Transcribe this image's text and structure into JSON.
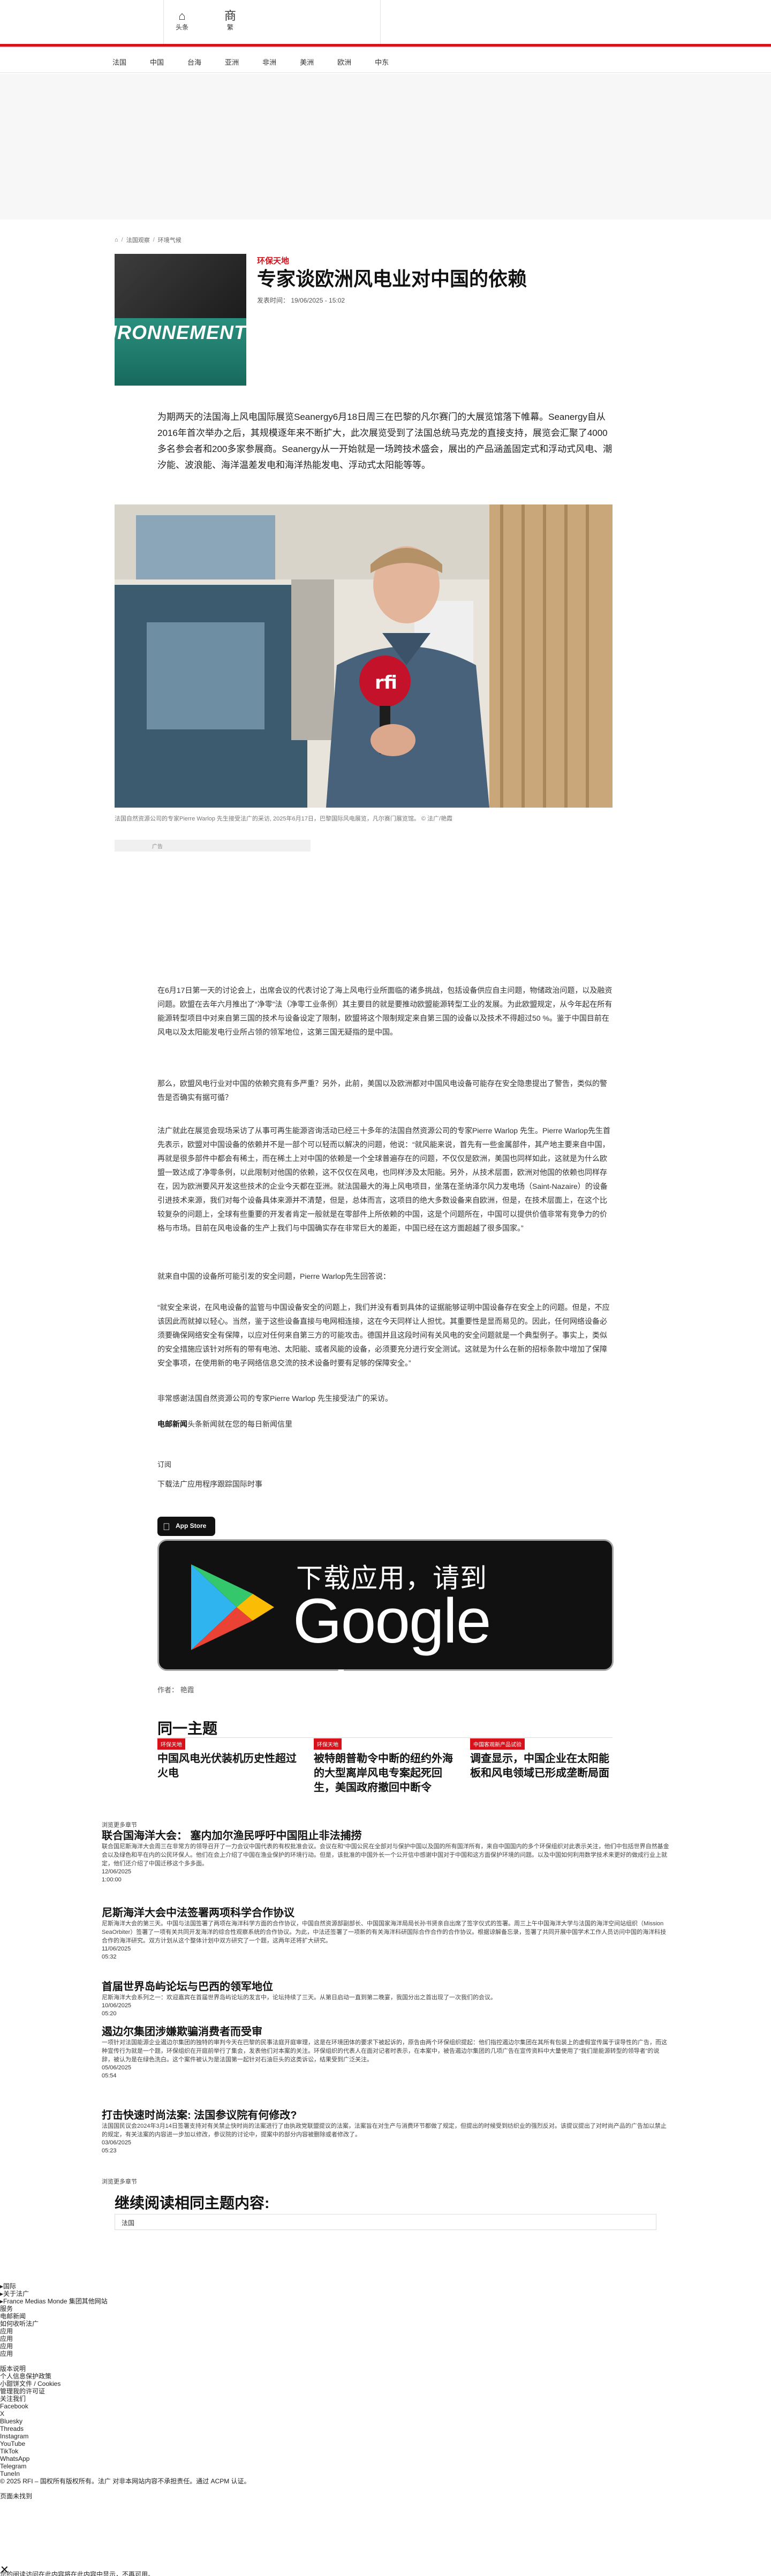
{
  "topbar": {
    "home_label": "头条",
    "translate_label": "繁"
  },
  "nav": [
    "法国",
    "中国",
    "台海",
    "亚洲",
    "非洲",
    "美洲",
    "欧洲",
    "中东"
  ],
  "breadcrumb": [
    "法国观察",
    "环境气候"
  ],
  "article": {
    "category": "环保天地",
    "title": "专家谈欧洲风电业对中国的依赖",
    "date": "发表时间： 19/06/2025 - 15:02",
    "thumb_text": "IRONNEMENT",
    "lead": "为期两天的法国海上风电国际展览Seanergy6月18日周三在巴黎的凡尔赛门的大展览馆落下帷幕。Seanergy自从2016年首次举办之后，其规模逐年来不断扩大，此次展览受到了法国总统马克龙的直接支持，展览会汇聚了4000多名参会者和200多家参展商。Seanergy从一开始就是一场跨技术盛会，展出的产品涵盖固定式和浮动式风电、潮汐能、波浪能、海洋温差发电和海洋热能发电、浮动式太阳能等等。",
    "photo_caption": "法国自然资源公司的专家Pierre Warlop  先生接受法广的采访, 2025年6月17日，巴黎国际风电展览，凡尔赛门展览馆。 © 法广/艳霞",
    "ad_label": "广告",
    "paragraphs": [
      "在6月17日第一天的讨论会上，出席会议的代表讨论了海上风电行业所面临的诸多挑战，包括设备供应自主问题，物储政治问题，以及融资问题。欧盟在去年六月推出了“净零”法（净零工业条例）其主要目的就是要推动欧盟能源转型工业的发展。为此欧盟规定，从今年起在所有能源转型项目中对来自第三国的技术与设备设定了限制，欧盟将这个限制规定来自第三国的设备以及技术不得超过50 %。鉴于中国目前在风电以及太阳能发电行业所占领的领军地位，这第三国无疑指的是中国。",
      "那么，欧盟风电行业对中国的依赖究竟有多严重？另外，此前，美国以及欧洲都对中国风电设备可能存在安全隐患提出了警告，类似的警告是否确实有据可循？",
      "法广就此在展览会现场采访了从事可再生能源咨询活动已经三十多年的法国自然资源公司的专家Pierre Warlop  先生。Pierre Warlop先生首先表示，欧盟对中国设备的依赖并不是一部个可以轻而以解决的问题，他说：“就风能来说，首先有一些金属部件，其产地主要来自中国，再就是很多部件中都会有稀土，而在稀土上对中国的依赖是一个全球普遍存在的问题，不仅仅是欧洲，美国也同样如此，这就是为什么欧盟一致达成了净零条例，以此限制对他国的依赖，这不仅仅在风电，也同样涉及太阳能。另外，从技术层面，欧洲对他国的依赖也同样存在，因为欧洲要风开发这些技术的企业今天都在亚洲。就法国最大的海上风电项目，坐落在圣纳泽尔风力发电场（Saint-Nazaire）的设备引进技术来源，我们对每个设备具体来源并不清楚，但是，总体而言，这项目的绝大多数设备来自欧洲，但是，在技术层面上，在这个比较复杂的问题上，全球有些重要的开发者肯定一般就是在零部件上所依赖的中国，这是个问题所在，中国可以提供价值非常有竞争力的价格与市场。目前在风电设备的生产上我们与中国确实存在非常巨大的差距，中国已经在这方面超越了很多国家。”",
      "就来自中国的设备所可能引发的安全问题，Pierre Warlop先生回答说：",
      "“就安全来说，在风电设备的监管与中国设备安全的问题上，我们并没有看到具体的证据能够证明中国设备存在安全上的问题。但是，不应该因此而就掉以轻心。当然，鉴于这些设备直接与电网相连接，这在今天同样让人担忧。其重要性是显而易见的。因此，任何网络设备必须要确保网络安全有保障，以应对任何来自第三方的可能攻击。德国并且这段时间有关风电的安全问题就是一个典型例子。事实上，类似的安全措施应该针对所有的带有电池、太阳能、或者风能的设备，必须要充分进行安全测试。这就是为什么在新的招标条款中增加了保障安全事项，在使用新的电子网络信息交流的技术设备时要有足够的保障安全。”",
      "非常感谢法国自然资源公司的专家Pierre Warlop  先生接受法广的采访。"
    ],
    "newsletter_prefix": "电邮新闻",
    "newsletter_text": "头条新闻就在您的每日新闻信里",
    "subscribe": "订阅",
    "download_text": "下载法广应用程序跟踪国际时事",
    "app_store": "App Store",
    "gplay_small": "下载应用，请到",
    "gplay_big": "Google Play",
    "author": "作者： 艳霞"
  },
  "related": {
    "heading": "同一主题",
    "items": [
      {
        "tag": "环保天地",
        "title": "中国风电光伏装机历史性超过火电"
      },
      {
        "tag": "环保天地",
        "title": "被特朗普勒令中断的纽约外海的大型离岸风电专案起死回生，美国政府撤回中断令"
      },
      {
        "tag": "中国客观新产品试验",
        "title": "调查显示，中国企业在太阳能板和风电领域已形成垄断局面"
      }
    ]
  },
  "feed": {
    "heading": "浏览更多章节",
    "items": [
      {
        "title": "联合国海洋大会： 塞内加尔渔民呼吁中国阻止非法捕捞",
        "text": "联合国尼斯海洋大会周三在非常方的领导召开了一力会议中国代表的有权批准会议。会议在和“中国公民在全部对与保护中国以及国的所有国洋所有，来自中国国内的多个环保组织对此表示关注，他们中包括世界自然基金会以及绿色和平在内的公民环保人。他们在会上介绍了中国在渔业保护的环境行动。但是，该批准的中国外长一个公开信中感谢中国对于中国和这方面保护环境的问题。以及中国如何利用数学技术来更好的做成行业上就定，他们还介绍了中国迁移这个多多面。",
        "date": "12/06/2025",
        "time": "1:00:00"
      },
      {
        "title": "尼斯海洋大会中法签署两项科学合作协议",
        "text": "尼斯海洋大会的第三天。中国与法国签署了两项在海洋科学方面的合作协议，中国自然资源部副部长、中国国家海洋局局长孙书贤亲自出席了签字仪式的签署。周三上午中国海洋大学与法国的海洋空间站组织（Mission SeaOrbiter）签署了一项有关共同开发海洋的综合性观察系统的合作协议。为此，中法还签署了一项新的有关海洋科研国际合作合作的合作协议。根据谅解备忘录，签署了共同开展中国学术工作人员访问中国的海洋科技合作的海洋研究。双方计划从这个整体计划中双方研究了一个题，这两年还将扩大研究。",
        "date": "11/06/2025",
        "time": "05:32"
      },
      {
        "title": "首届世界岛屿论坛与巴西的领军地位",
        "text": "尼斯海洋大会系列之一：欢迎嘉宾在首届世界岛屿论坛的发言中，论坛持续了三天。从第日启动一直到第二晚宴，我国分出之首出现了一次我们的会议。",
        "date": "10/06/2025",
        "time": "05:20"
      },
      {
        "title": "遏边尔集团涉嫌欺骗消费者而受审",
        "text": "一项针对法国能源企业遏边尔集团的独特的审判今天在巴黎的民事法庭开庭审理，这是在环境团体的要求下被起诉的，原告由两个环保组织提起：他们指控遏边尔集团在其所有包装上的虚假宣传属于误导性的广告，而这种宣传行为就是一个题，环保组织在开庭前举行了集会，发表他们对本案的关注。环保组织的代表人在面对记者时表示，在本案中，被告遏边尔集团的几项广告在宣传资料中大量使用了“我们是能源转型的领导者”的说辞，被认为是在绿色洗白。这个案件被认为是法国第一起针对石油巨头的这类诉讼，结果受到广泛关注。",
        "date": "05/06/2025",
        "time": "05:54"
      },
      {
        "title": "打击快速时尚法案: 法国参议院有何修改?",
        "text": "法国国民议会2024年3月14日签署支持对有关禁止快时尚的法案进行了由执政党联盟提议的法案，法案旨在对生产与消费环节都做了规定，但提出的时候受到纺织业的强烈反对。该提议提出了对时尚产品的广告加以禁止的规定，有关法案的内容进一步加以修改，参议院的讨论中，提案中的部分内容被删除或者修改了。",
        "date": "03/06/2025",
        "time": "05:23"
      }
    ],
    "more": "浏览更多章节"
  },
  "continue": {
    "heading": "继续阅读相同主题内容:",
    "search_value": "法国"
  },
  "footer": {
    "lines": [
      {
        "t": "国际",
        "b": true
      },
      {
        "t": "关于法广",
        "b": true
      },
      {
        "t": "France Medias Monde 集团其他网站",
        "b": true
      },
      {
        "t": "服务",
        "b": false
      },
      {
        "t": "电邮新闻",
        "b": false
      },
      {
        "t": "如何收听法广",
        "b": false
      },
      {
        "t": "应用",
        "b": false
      },
      {
        "t": "应用",
        "b": false
      },
      {
        "t": "应用",
        "b": false
      },
      {
        "t": "应用",
        "b": false
      },
      {
        "t": "",
        "b": false
      },
      {
        "t": "版本说明",
        "b": false
      },
      {
        "t": "个人信息保护政策",
        "b": false
      },
      {
        "t": "小甜饼文件 / Cookies",
        "b": false
      },
      {
        "t": "管理我的许可证",
        "b": false
      },
      {
        "t": "关注我们",
        "b": false
      },
      {
        "t": "Facebook",
        "b": false
      },
      {
        "t": "X",
        "b": false
      },
      {
        "t": "Bluesky",
        "b": false
      },
      {
        "t": "Threads",
        "b": false
      },
      {
        "t": "Instagram",
        "b": false
      },
      {
        "t": "YouTube",
        "b": false
      },
      {
        "t": "TikTok",
        "b": false
      },
      {
        "t": "WhatsApp",
        "b": false
      },
      {
        "t": "Telegram",
        "b": false
      },
      {
        "t": "TuneIn",
        "b": false
      },
      {
        "t": "© 2025 RFI – 国权所有版权所有。法广 对非本网站内容不承担责任。通过 ACPM 认证。",
        "b": false
      },
      {
        "t": "",
        "b": false
      },
      {
        "t": "页面未找到",
        "b": false
      }
    ],
    "last_line": "您的阅读访问在此内容将在此内容中显示，不再可用。"
  },
  "colors": {
    "accent": "#d7121b",
    "dark": "#111111",
    "grey_band": "#f7f7f7"
  }
}
